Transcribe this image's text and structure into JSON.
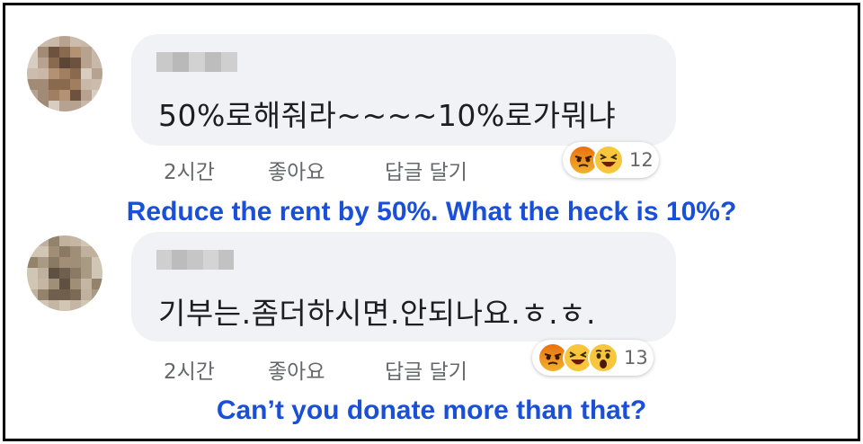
{
  "comments": [
    {
      "text": "50%로해줘라~~~~10%로가뭐냐",
      "time": "2시간",
      "like": "좋아요",
      "reply": "답글 달기",
      "reaction_count": "12",
      "reactions": [
        "angry-icon",
        "haha-icon"
      ],
      "caption": "Reduce the rent by 50%. What the heck is 10%?"
    },
    {
      "text": "기부는.좀더하시면.안되나요.ㅎ.ㅎ.",
      "time": "2시간",
      "like": "좋아요",
      "reply": "답글 달기",
      "reaction_count": "13",
      "reactions": [
        "angry-icon",
        "haha-icon",
        "wow-icon"
      ],
      "caption": "Can’t you donate more than that?"
    }
  ],
  "colors": {
    "bubble": "#f0f2f5",
    "caption": "#1a4fd8",
    "meta": "#65676b",
    "text": "#1c1e21"
  }
}
